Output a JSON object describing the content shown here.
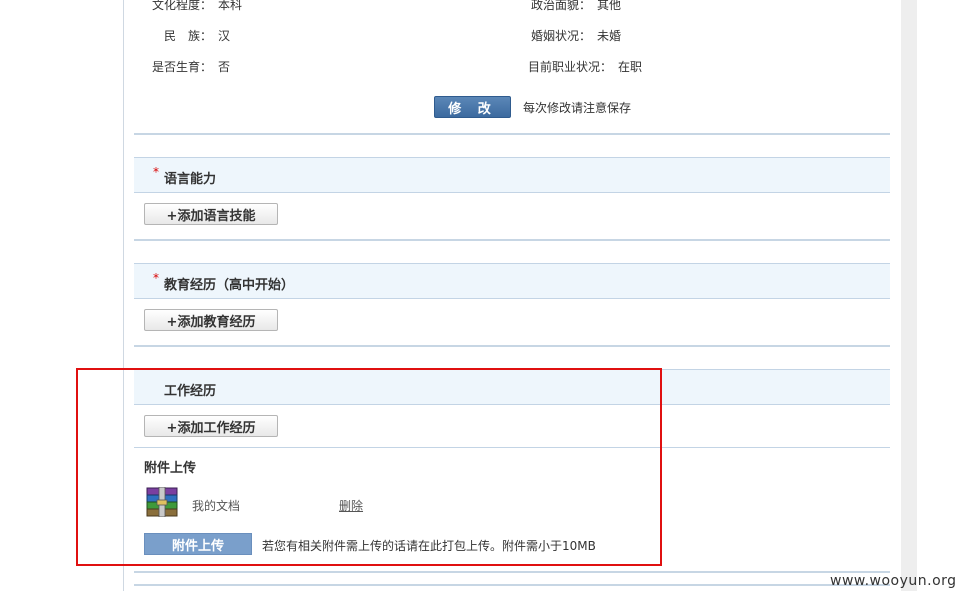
{
  "personal_info": {
    "education": {
      "label": "文化程度：",
      "value": "本科"
    },
    "political": {
      "label": "政治面貌：",
      "value": "其他"
    },
    "ethnicity": {
      "label": "民　族：",
      "value": "汉"
    },
    "marital": {
      "label": "婚姻状况：",
      "value": "未婚"
    },
    "childbirth": {
      "label": "是否生育：",
      "value": "否"
    },
    "employment": {
      "label": "目前职业状况：",
      "value": "在职"
    }
  },
  "save": {
    "button_label": "修 改",
    "note": "每次修改请注意保存"
  },
  "sections": {
    "language": {
      "required_mark": "*",
      "title": "语言能力",
      "add_label": "+添加语言技能"
    },
    "education": {
      "required_mark": "*",
      "title": "教育经历（高中开始）",
      "add_label": "+添加教育经历"
    },
    "work": {
      "title": "工作经历",
      "add_label": "+添加工作经历"
    }
  },
  "attachments": {
    "title": "附件上传",
    "file": {
      "name": "我的文档",
      "delete_label": "删除",
      "icon": "archive-file-icon"
    },
    "upload_label": "附件上传",
    "upload_note": "若您有相关附件需上传的话请在此打包上传。附件需小于10MB"
  },
  "watermark": "www.wooyun.org",
  "colors": {
    "highlight": "#e01010",
    "primary_button": "#3c6a9f",
    "section_bg": "#eef6fc"
  }
}
